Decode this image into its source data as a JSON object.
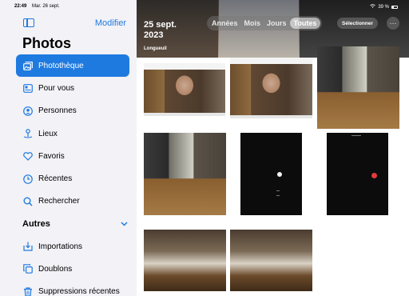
{
  "status_bar": {
    "time": "22:49",
    "date": "Mar. 26 sept.",
    "battery": "39 %"
  },
  "sidebar": {
    "edit_label": "Modifier",
    "title": "Photos",
    "items": [
      {
        "label": "Photothèque",
        "icon": "photo-library-icon",
        "active": true
      },
      {
        "label": "Pour vous",
        "icon": "for-you-icon"
      },
      {
        "label": "Personnes",
        "icon": "people-icon"
      },
      {
        "label": "Lieux",
        "icon": "location-pin-icon"
      },
      {
        "label": "Favoris",
        "icon": "heart-icon"
      },
      {
        "label": "Récentes",
        "icon": "clock-icon"
      },
      {
        "label": "Rechercher",
        "icon": "search-icon"
      }
    ],
    "section_title": "Autres",
    "others": [
      {
        "label": "Importations",
        "icon": "import-icon"
      },
      {
        "label": "Doublons",
        "icon": "duplicates-icon"
      },
      {
        "label": "Suppressions récentes",
        "icon": "trash-icon"
      }
    ]
  },
  "library": {
    "date_line1": "25 sept.",
    "date_line2": "2023",
    "location": "Longueuil",
    "segments": [
      "Années",
      "Mois",
      "Jours",
      "Toutes"
    ],
    "active_segment": "Toutes",
    "select_label": "Sélectionner",
    "more_label": "···"
  },
  "colors": {
    "accent": "#1f7ae0",
    "sidebar_bg": "#f2f2f7"
  }
}
